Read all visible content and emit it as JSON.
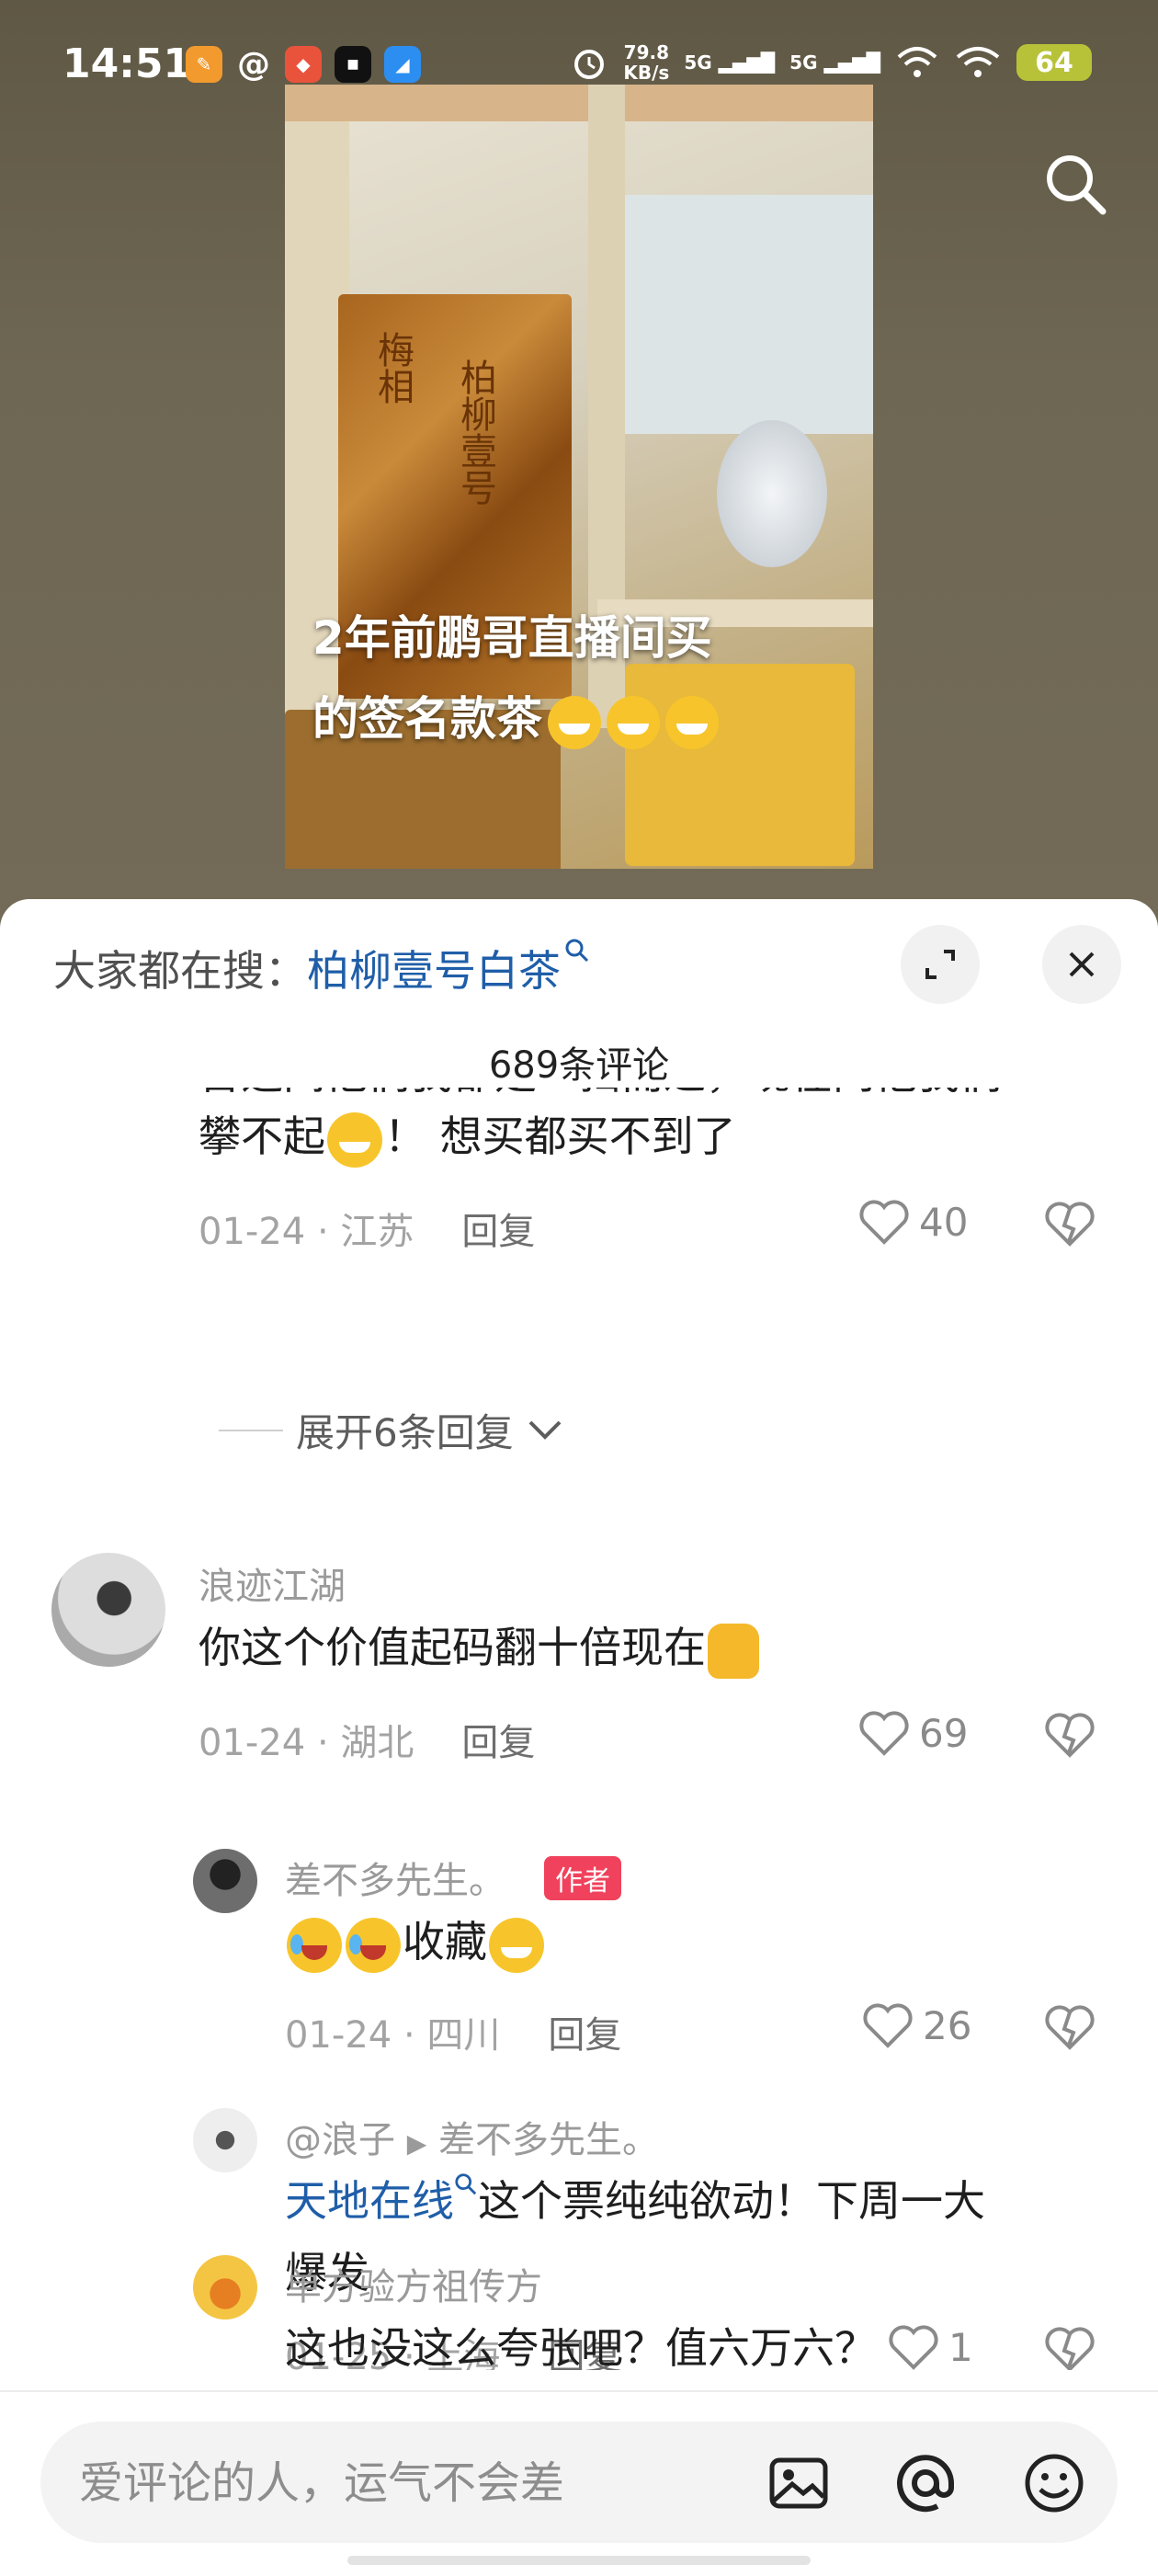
{
  "status": {
    "time": "14:51",
    "net_speed": "79.8",
    "net_unit": "KB/s",
    "sig1": "5G",
    "sig2": "5G",
    "battery": "64"
  },
  "video": {
    "caption_line1": "2年前鹏哥直播间买",
    "caption_line2": "的签名款茶"
  },
  "sheet": {
    "hot_label": "大家都在搜：",
    "hot_keyword": "柏柳壹号白茶",
    "comment_count": "689条评论"
  },
  "comments": [
    {
      "text_tail": "攀不起",
      "text_tail2": "！ 想买都买不到了",
      "date": "01-24 · 江苏",
      "reply": "回复",
      "likes": "40"
    },
    {
      "expand": "展开6条回复"
    },
    {
      "name": "浪迹江湖",
      "text": "你这个价值起码翻十倍现在",
      "date": "01-24 · 湖北",
      "reply": "回复",
      "likes": "69"
    },
    {
      "name": "差不多先生。",
      "tag": "作者",
      "text": "收藏",
      "date": "01-24 · 四川",
      "reply": "回复",
      "likes": "26"
    },
    {
      "name": "@浪子",
      "reply_to": "差不多先生。",
      "link": "天地在线",
      "text_a": "这个票纯纯欲动！下周一大",
      "text_b": "爆发",
      "date": "01-25 · 上海",
      "reply": "回复",
      "likes": "1"
    },
    {
      "name": "单方验方祖传方",
      "text": "这也没这么夸张吧？值六万六？"
    }
  ],
  "input": {
    "placeholder": "爱评论的人，运气不会差"
  },
  "colors": {
    "link": "#1f5ea8",
    "author_tag": "#f0425c"
  }
}
